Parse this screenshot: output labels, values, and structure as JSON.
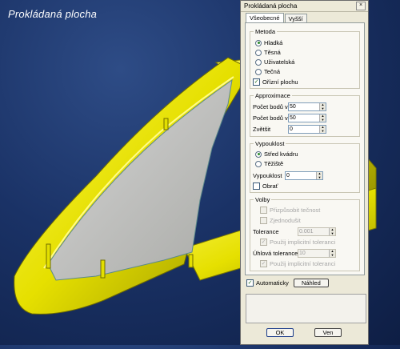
{
  "viewport": {
    "title": "Prokládaná plocha"
  },
  "dialog": {
    "title": "Prokládaná plocha",
    "close_glyph": "×",
    "tabs": [
      {
        "label": "Všeobecné",
        "active": true
      },
      {
        "label": "Vyšší",
        "active": false
      }
    ],
    "metoda": {
      "title": "Metoda",
      "options": [
        {
          "label": "Hladká",
          "selected": true
        },
        {
          "label": "Těsná",
          "selected": false
        },
        {
          "label": "Uživatelská",
          "selected": false
        },
        {
          "label": "Tečná",
          "selected": false
        }
      ],
      "trim": {
        "label": "Ořízní plochu",
        "checked": true
      }
    },
    "approximace": {
      "title": "Approximace",
      "fields": [
        {
          "label": "Počet bodů v x",
          "value": "50"
        },
        {
          "label": "Počet bodů v y",
          "value": "50"
        },
        {
          "label": "Zvětšit",
          "value": "0"
        }
      ]
    },
    "vypouklost": {
      "title": "Vypouklost",
      "options": [
        {
          "label": "Střed kvádru",
          "selected": true
        },
        {
          "label": "Těžiště",
          "selected": false
        }
      ],
      "field": {
        "label": "Vypouklost",
        "value": "0"
      },
      "reverse": {
        "label": "Obrať",
        "checked": false
      }
    },
    "volby": {
      "title": "Volby",
      "adapt": {
        "label": "Přizpůsobit tečnost",
        "checked": false
      },
      "simplify": {
        "label": "Zjednodušit",
        "checked": false
      },
      "tolerance": {
        "label": "Tolerance",
        "value": "0.001"
      },
      "use_implicit_tol": {
        "label": "Použij implicitní toleranci",
        "checked": true
      },
      "angle_tolerance": {
        "label": "Úhlová tolerance",
        "value": "10"
      },
      "use_implicit_tol2": {
        "label": "Použij implicitní toleranci",
        "checked": true
      }
    },
    "automatic": {
      "label": "Automaticky",
      "checked": true
    },
    "preview_label": "Náhled",
    "ok_label": "OK",
    "cancel_label": "Ven"
  },
  "colors": {
    "background_top": "#2e4c86",
    "background_bottom": "#0e1e44",
    "part_yellow": "#e9e500",
    "part_shadow": "#8a8700",
    "surface_gray": "#c8c8c8",
    "dialog_face": "#ece9d8"
  }
}
